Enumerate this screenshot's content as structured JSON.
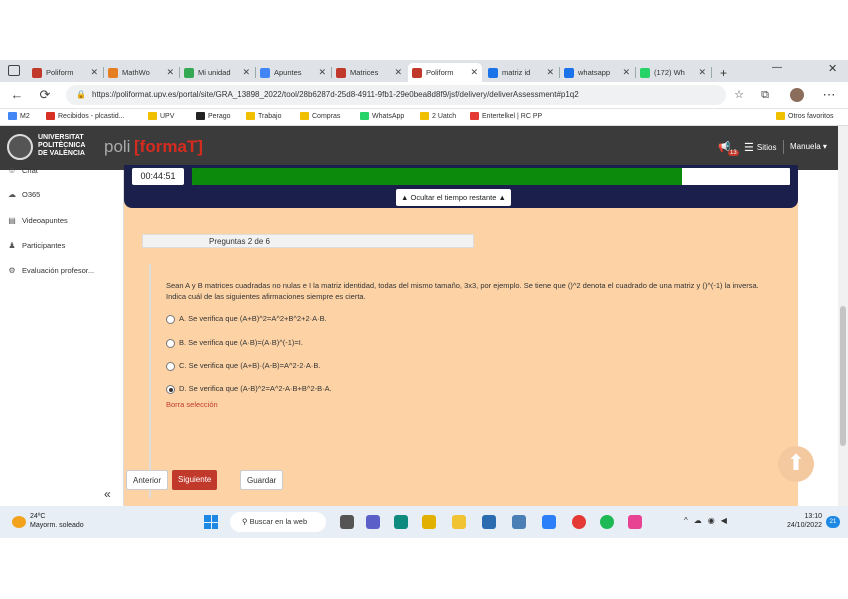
{
  "browser": {
    "tabs": [
      {
        "label": "Poliform",
        "color": "#c0392b",
        "active": false
      },
      {
        "label": "MathWo",
        "color": "#e67e22",
        "active": false
      },
      {
        "label": "Mi unidad",
        "color": "#34a853",
        "active": false
      },
      {
        "label": "Apuntes",
        "color": "#4285f4",
        "active": false
      },
      {
        "label": "Matrices",
        "color": "#c0392b",
        "active": false
      },
      {
        "label": "Poliform",
        "color": "#c0392b",
        "active": true
      },
      {
        "label": "matriz id",
        "color": "#1a73e8",
        "active": false
      },
      {
        "label": "whatsapp",
        "color": "#1a73e8",
        "active": false
      },
      {
        "label": "(172) Wh",
        "color": "#25d366",
        "active": false
      }
    ],
    "url": "https://poliformat.upv.es/portal/site/GRA_13898_2022/tool/28b6287d-25d8-4911-9fb1-29e0bea8d8f9/jsf/delivery/deliverAssessment#p1q2",
    "bookmarks": [
      "M2",
      "Recibidos - plcastid...",
      "UPV",
      "Perago",
      "Trabajo",
      "Compras",
      "WhatsApp",
      "2 Uatch",
      "Entertelkel | RC PP"
    ],
    "other_bookmarks": "Otros favoritos"
  },
  "app": {
    "university": [
      "UNIVERSITAT",
      "POLITÈCNICA",
      "DE VALÈNCIA"
    ],
    "logo_poli": "poli",
    "logo_format": "[formaT]",
    "notif_count": "13",
    "sites_label": "Sitios",
    "user_label": "Manuela"
  },
  "sidebar": {
    "items": [
      {
        "label": "Chat",
        "icon": "chat-icon"
      },
      {
        "label": "O365",
        "icon": "cloud-icon"
      },
      {
        "label": "Videoapuntes",
        "icon": "video-icon"
      },
      {
        "label": "Participantes",
        "icon": "users-icon"
      },
      {
        "label": "Evaluación profesor...",
        "icon": "eval-icon"
      }
    ]
  },
  "timer": {
    "time": "00:44:51",
    "progress": 0.82,
    "hide_label": "▲ Ocultar el tiempo restante ▲"
  },
  "question": {
    "header": "Preguntas 2 de 6",
    "text": "Sean A y B matrices cuadradas no nulas e I la matriz identidad, todas del mismo tamaño, 3x3, por ejemplo. Se tiene que ()^2 denota el cuadrado de una matriz y ()^(-1) la inversa. Indica cuál de las siguientes afirmaciones siempre es cierta.",
    "options": [
      {
        "label": "A. Se verifica que (A+B)^2=A^2+B^2+2·A·B.",
        "selected": false
      },
      {
        "label": "B. Se verifica que (A·B)=(A·B)^(-1)=I.",
        "selected": false
      },
      {
        "label": "C. Se verifica que (A+B)·(A-B)=A^2-2·A·B.",
        "selected": false
      },
      {
        "label": "D. Se verifica que (A-B)^2=A^2-A·B+B^2-B·A.",
        "selected": true
      }
    ],
    "clear": "Borra selección"
  },
  "buttons": {
    "prev": "Anterior",
    "next": "Siguiente",
    "save": "Guardar"
  },
  "taskbar": {
    "temp": "24ºC",
    "weather": "Mayorm. soleado",
    "search": "Buscar en la web",
    "time": "13:10",
    "date": "24/10/2022",
    "notif": "21"
  },
  "colors": {
    "accent": "#c0392b",
    "timer_fill": "#0c8a0c",
    "main_bg": "#fdd3a6"
  }
}
